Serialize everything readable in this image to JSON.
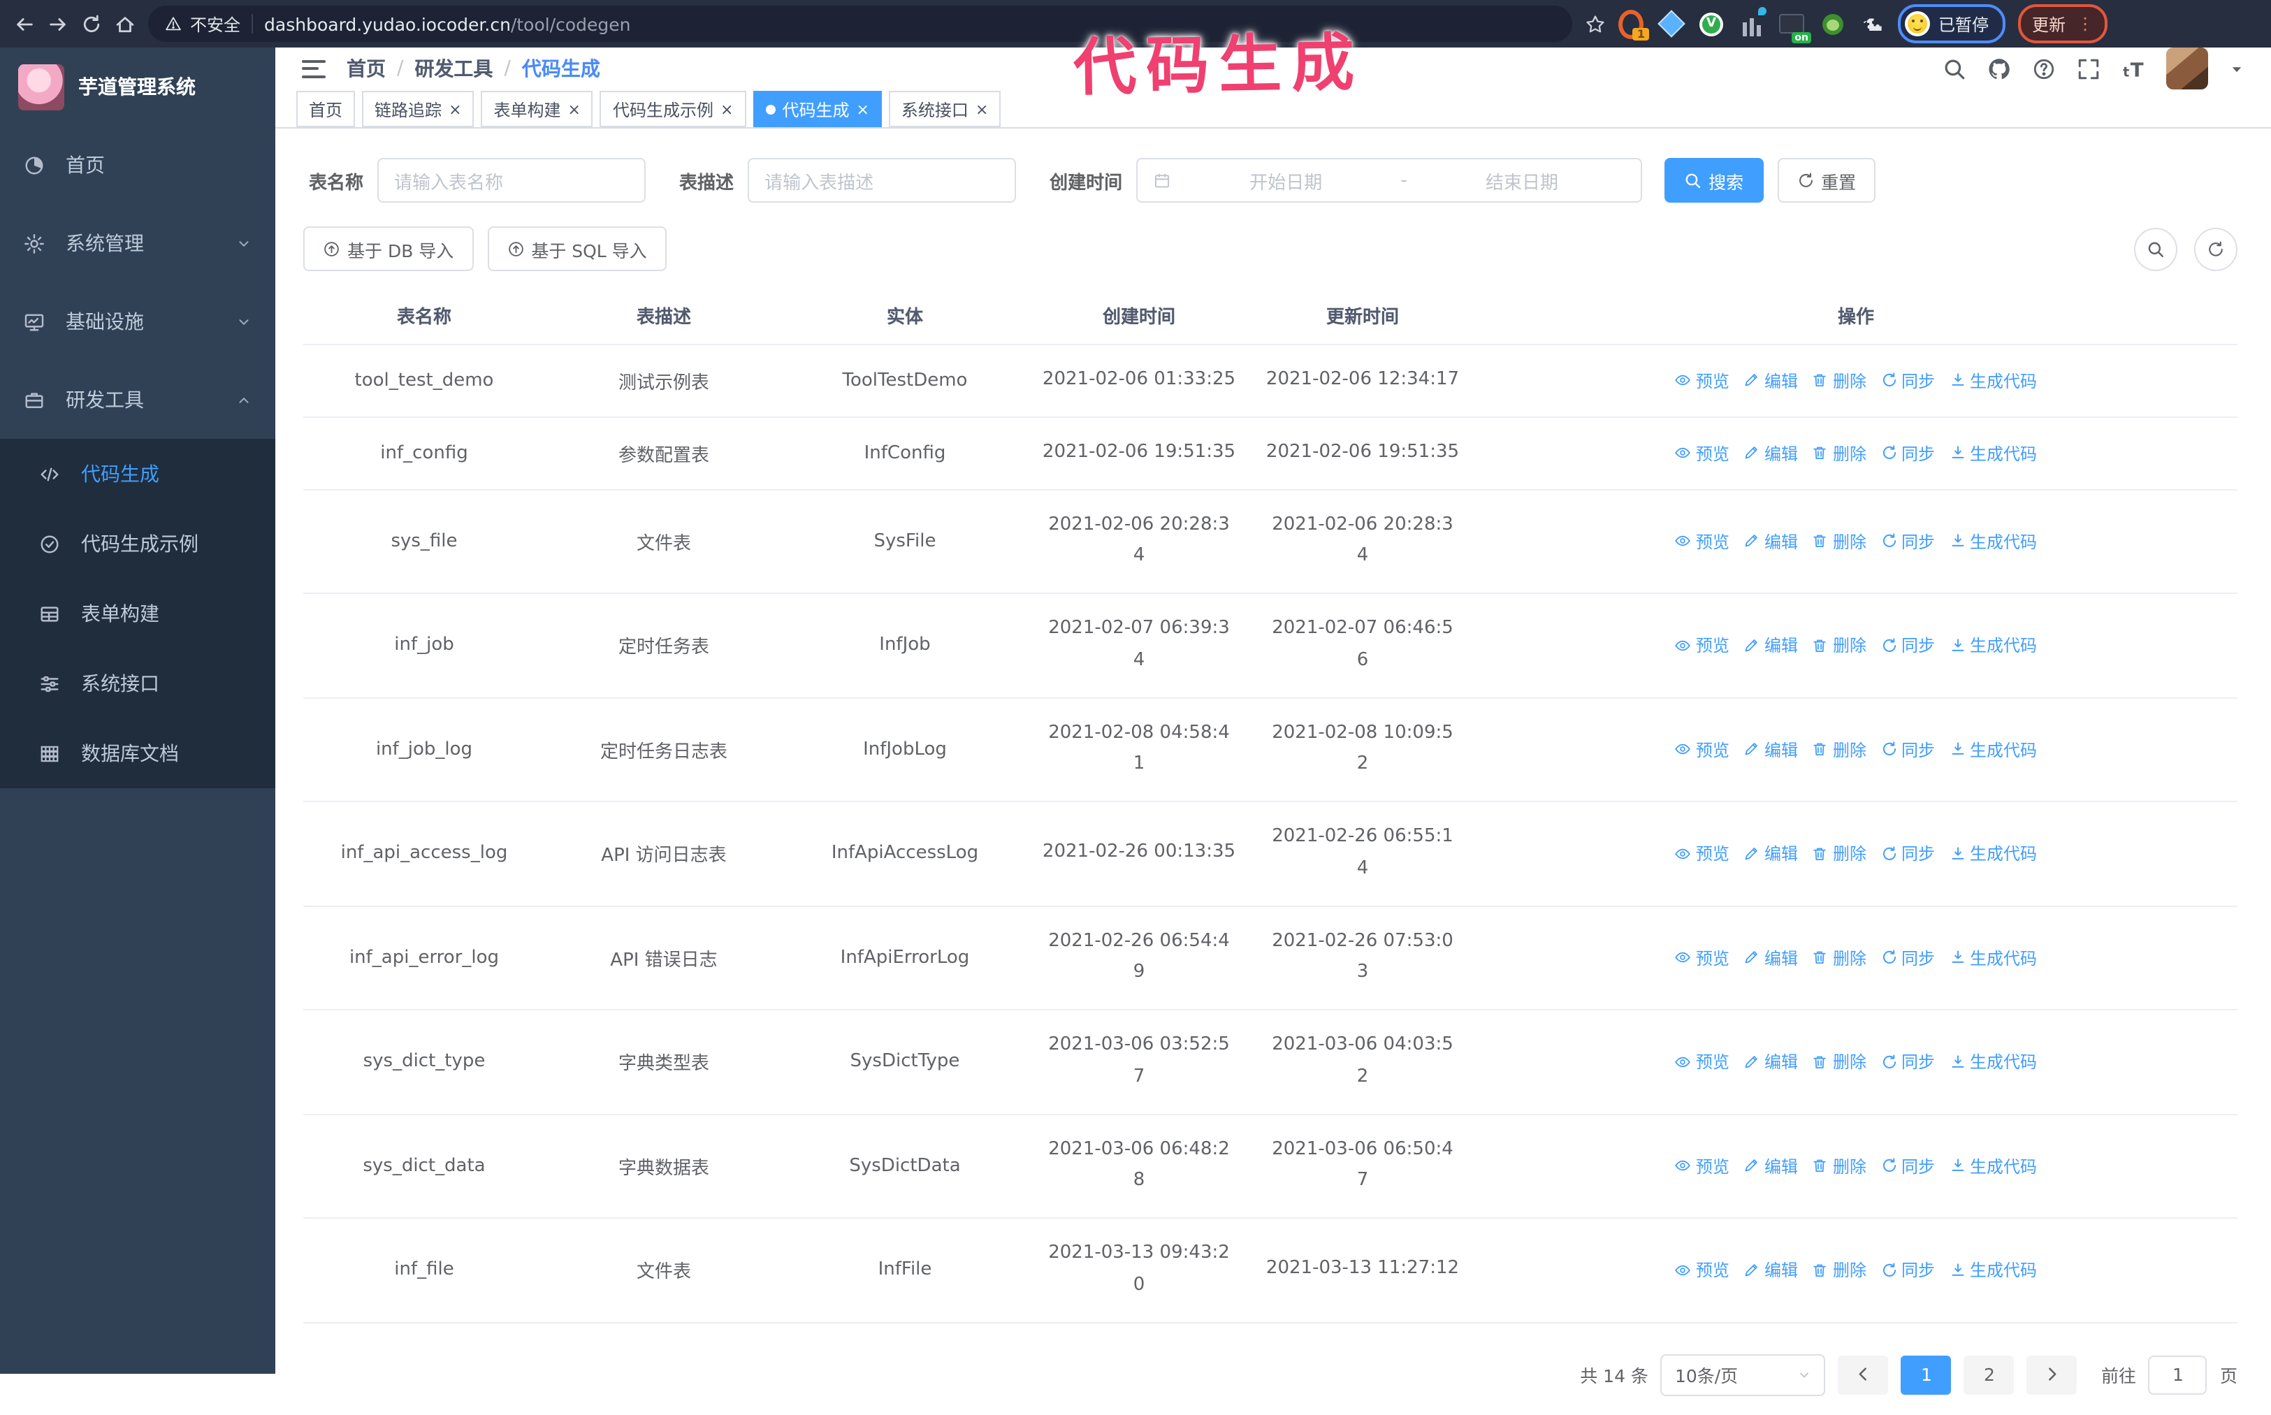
{
  "browser": {
    "security_label": "不安全",
    "url_host": "dashboard.yudao.iocoder.cn",
    "url_path": "/tool/codegen",
    "ext_badge": "1",
    "ext_on_badge": "on",
    "paused_label": "已暂停",
    "update_label": "更新"
  },
  "annotation": {
    "text": "代码生成",
    "color": "#ef4070"
  },
  "sidebar": {
    "title": "芋道管理系统",
    "menu": [
      {
        "label": "首页",
        "icon": "dashboard-icon"
      },
      {
        "label": "系统管理",
        "icon": "gear-icon",
        "chevron": "down"
      },
      {
        "label": "基础设施",
        "icon": "monitor-icon",
        "chevron": "down"
      },
      {
        "label": "研发工具",
        "icon": "briefcase-icon",
        "chevron": "up",
        "children": [
          {
            "label": "代码生成",
            "icon": "code-icon",
            "active": true
          },
          {
            "label": "代码生成示例",
            "icon": "check-circle-icon"
          },
          {
            "label": "表单构建",
            "icon": "form-icon"
          },
          {
            "label": "系统接口",
            "icon": "sliders-icon"
          },
          {
            "label": "数据库文档",
            "icon": "database-icon"
          }
        ]
      }
    ]
  },
  "header": {
    "breadcrumb": [
      "首页",
      "研发工具",
      "代码生成"
    ],
    "breadcrumb_separator": "/",
    "tabs": [
      {
        "label": "首页",
        "closable": false,
        "active": false
      },
      {
        "label": "链路追踪",
        "closable": true,
        "active": false
      },
      {
        "label": "表单构建",
        "closable": true,
        "active": false
      },
      {
        "label": "代码生成示例",
        "closable": true,
        "active": false
      },
      {
        "label": "代码生成",
        "closable": true,
        "active": true
      },
      {
        "label": "系统接口",
        "closable": true,
        "active": false
      }
    ]
  },
  "filters": {
    "name_label": "表名称",
    "name_placeholder": "请输入表名称",
    "desc_label": "表描述",
    "desc_placeholder": "请输入表描述",
    "time_label": "创建时间",
    "start_placeholder": "开始日期",
    "range_separator": "-",
    "end_placeholder": "结束日期",
    "search_label": "搜索",
    "reset_label": "重置"
  },
  "toolbar": {
    "import_db_label": "基于 DB 导入",
    "import_sql_label": "基于 SQL 导入"
  },
  "table": {
    "columns": [
      "表名称",
      "表描述",
      "实体",
      "创建时间",
      "更新时间",
      "操作"
    ],
    "actions": [
      "预览",
      "编辑",
      "删除",
      "同步",
      "生成代码"
    ],
    "rows": [
      {
        "name": "tool_test_demo",
        "desc": "测试示例表",
        "entity": "ToolTestDemo",
        "created": "2021-02-06 01:33:25",
        "updated": "2021-02-06 12:34:17",
        "wrap_created": false,
        "wrap_updated": false
      },
      {
        "name": "inf_config",
        "desc": "参数配置表",
        "entity": "InfConfig",
        "created": "2021-02-06 19:51:35",
        "updated": "2021-02-06 19:51:35",
        "wrap_created": false,
        "wrap_updated": false
      },
      {
        "name": "sys_file",
        "desc": "文件表",
        "entity": "SysFile",
        "created": "2021-02-06 20:28:34",
        "updated": "2021-02-06 20:28:34",
        "wrap_created": true,
        "wrap_updated": true
      },
      {
        "name": "inf_job",
        "desc": "定时任务表",
        "entity": "InfJob",
        "created": "2021-02-07 06:39:34",
        "updated": "2021-02-07 06:46:56",
        "wrap_created": true,
        "wrap_updated": true
      },
      {
        "name": "inf_job_log",
        "desc": "定时任务日志表",
        "entity": "InfJobLog",
        "created": "2021-02-08 04:58:41",
        "updated": "2021-02-08 10:09:52",
        "wrap_created": true,
        "wrap_updated": true
      },
      {
        "name": "inf_api_access_log",
        "desc": "API 访问日志表",
        "entity": "InfApiAccessLog",
        "created": "2021-02-26 00:13:35",
        "updated": "2021-02-26 06:55:14",
        "wrap_created": false,
        "wrap_updated": true
      },
      {
        "name": "inf_api_error_log",
        "desc": "API 错误日志",
        "entity": "InfApiErrorLog",
        "created": "2021-02-26 06:54:49",
        "updated": "2021-02-26 07:53:03",
        "wrap_created": true,
        "wrap_updated": true
      },
      {
        "name": "sys_dict_type",
        "desc": "字典类型表",
        "entity": "SysDictType",
        "created": "2021-03-06 03:52:57",
        "updated": "2021-03-06 04:03:52",
        "wrap_created": true,
        "wrap_updated": true
      },
      {
        "name": "sys_dict_data",
        "desc": "字典数据表",
        "entity": "SysDictData",
        "created": "2021-03-06 06:48:28",
        "updated": "2021-03-06 06:50:47",
        "wrap_created": true,
        "wrap_updated": true
      },
      {
        "name": "inf_file",
        "desc": "文件表",
        "entity": "InfFile",
        "created": "2021-03-13 09:43:20",
        "updated": "2021-03-13 11:27:12",
        "wrap_created": true,
        "wrap_updated": false
      }
    ]
  },
  "pagination": {
    "total_text": "共 14 条",
    "page_size_text": "10条/页",
    "pages": [
      "1",
      "2"
    ],
    "current_page": "1",
    "goto_label": "前往",
    "goto_value": "1",
    "goto_suffix": "页"
  }
}
